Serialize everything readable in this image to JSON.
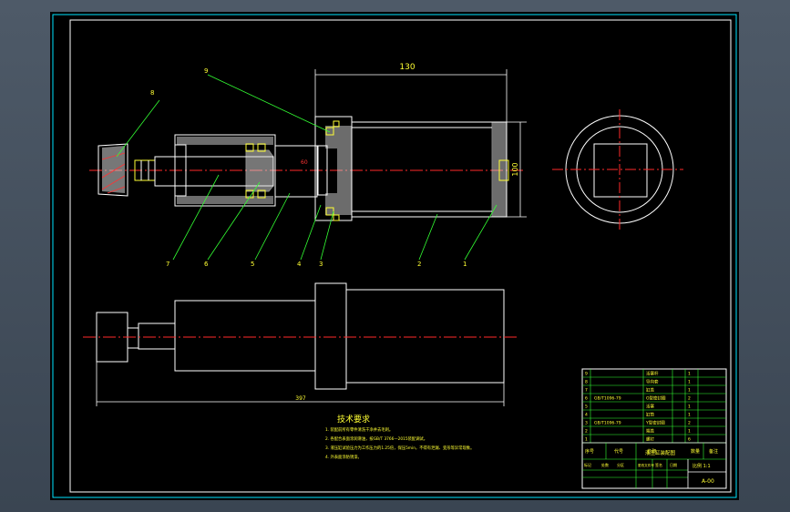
{
  "drawing": {
    "callouts": [
      "8",
      "9",
      "7",
      "6",
      "5",
      "4",
      "3",
      "2",
      "1"
    ],
    "dimensions": {
      "top_length": "130",
      "right_height": "100",
      "bore_mark": "60",
      "overall_length": "397"
    },
    "technical_requirements": {
      "title": "技术要求",
      "lines": [
        "1. 装配前所有零件清洗干净并去毛刺。",
        "2. 各配合表面涂润滑油，按GB/T 3766—2015装配调试。",
        "3. 液压缸试验压力为工作压力的1.25倍，保压5min，不得有泄漏、变形等异常现象。",
        "4. 外表面涂防锈漆。"
      ]
    },
    "title_block": {
      "parts": [
        {
          "no": "9",
          "name": "活塞杆",
          "qty": "1"
        },
        {
          "no": "8",
          "name": "导向套",
          "qty": "1"
        },
        {
          "no": "7",
          "name": "缸盖",
          "qty": "1"
        },
        {
          "no": "6",
          "name": "O型密封圈",
          "qty": "2"
        },
        {
          "no": "5",
          "name": "活塞",
          "qty": "1"
        },
        {
          "no": "4",
          "name": "缸筒",
          "qty": "1"
        },
        {
          "no": "3",
          "name": "Y型密封圈",
          "qty": "2"
        },
        {
          "no": "2",
          "name": "端盖",
          "qty": "1"
        },
        {
          "no": "1",
          "name": "螺钉",
          "qty": "6"
        }
      ],
      "std_codes": [
        "GB/T1096-79",
        "GB/T1096-79"
      ],
      "header": [
        "序号",
        "代号",
        "名称",
        "数量",
        "备注"
      ],
      "drawing_title": "液压缸装配图",
      "scale": "比例 1:1",
      "sheet_no": "A-00",
      "sign_row": [
        "标记",
        "处数",
        "分区",
        "更改文件号",
        "签名",
        "日期"
      ]
    }
  }
}
